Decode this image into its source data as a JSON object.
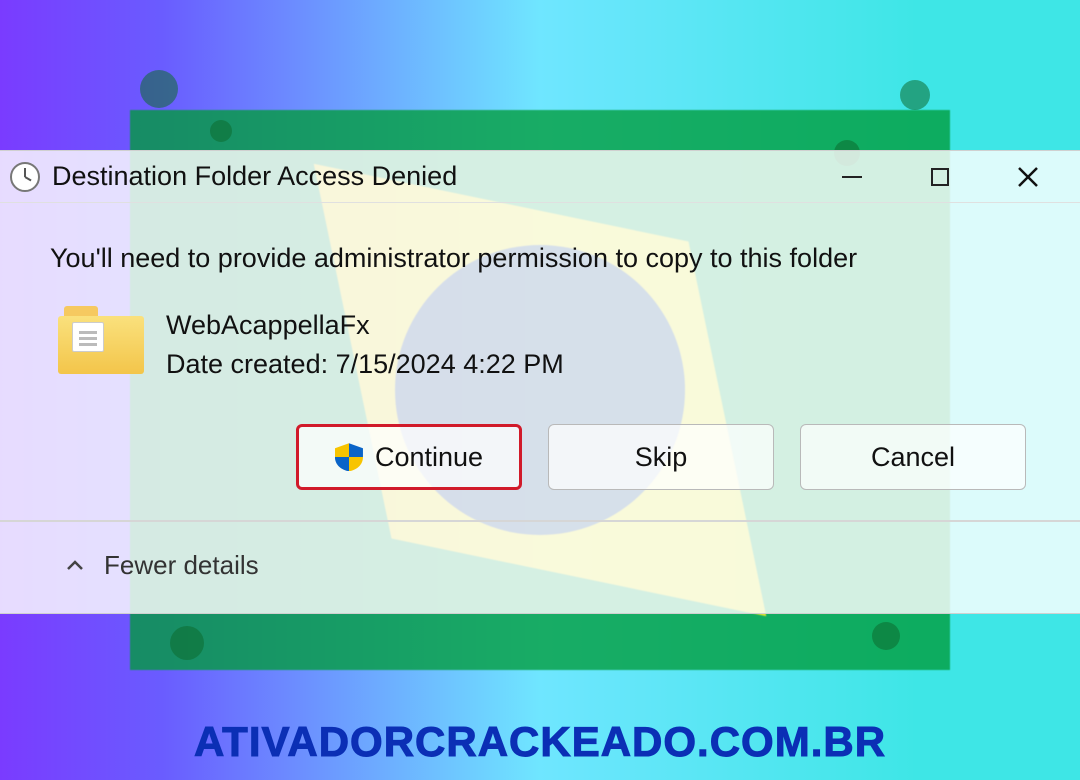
{
  "dialog": {
    "title": "Destination Folder Access Denied",
    "message": "You'll need to provide administrator permission to copy to this folder",
    "item": {
      "name": "WebAcappellaFx",
      "date_label": "Date created: 7/15/2024 4:22 PM"
    },
    "buttons": {
      "continue": "Continue",
      "skip": "Skip",
      "cancel": "Cancel"
    },
    "details_toggle": "Fewer details"
  },
  "watermark": "ATIVADORCRACKEADO.COM.BR"
}
